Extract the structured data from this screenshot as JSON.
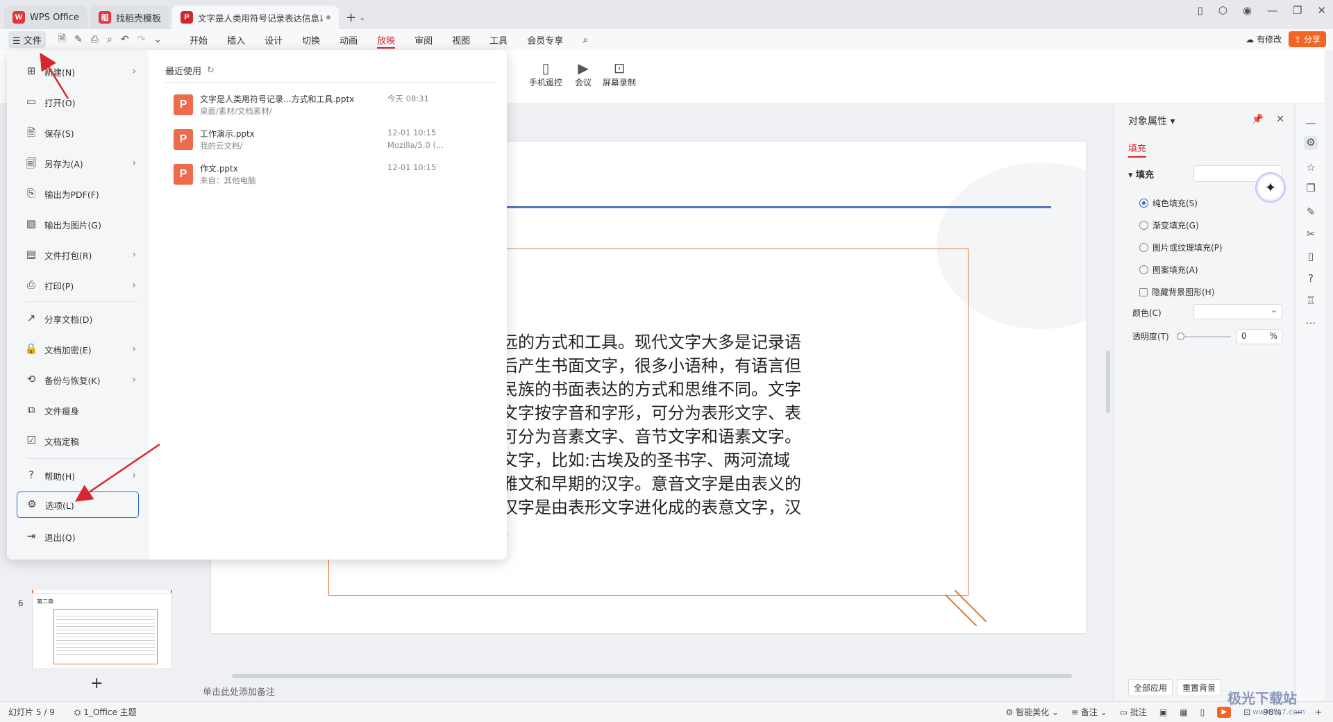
{
  "tabs": [
    {
      "label": "WPS Office",
      "logo": "W",
      "color": "#e8343b"
    },
    {
      "label": "找稻壳模板",
      "logo": "稻",
      "color": "#e8343b"
    },
    {
      "label": "文字是人类用符号记录表达信息以",
      "logo": "P",
      "color": "#d2272b"
    }
  ],
  "menubar": {
    "file_label": "☰ 文件",
    "items": [
      "开始",
      "插入",
      "设计",
      "切换",
      "动画",
      "放映",
      "审阅",
      "视图",
      "工具",
      "会员专享"
    ],
    "active": "放映",
    "modified": "有修改",
    "share": "分享"
  },
  "ribbon_tools": [
    {
      "label": "手机遥控",
      "icon": "phone-icon"
    },
    {
      "label": "会议",
      "icon": "video-icon"
    },
    {
      "label": "屏幕录制",
      "icon": "record-icon"
    }
  ],
  "slide": {
    "lines": [
      "达信息以传之久远的方式和工具。现代文字大多是记录语",
      "先有口头的语言后产生书面文字，很多小语种，有语言但",
      "同体现了国家和民族的书面表达的方式和思维不同。文字",
      "录的文明社会。文字按字音和字形，可分为表形文字、表",
      "按语音和语素，可分为音素文字、音节文字和语素文字。",
      "原生文字的象形文字，比如:古埃及的圣书字、两河流域",
      "文字、美洲的玛雅文和早期的汉字。意音文字是由表义的",
      "旁组成的文字，汉字是由表形文字进化成的表意文字，汉",
      "是一种二维文字。"
    ]
  },
  "thumbnails": {
    "num6": "6",
    "title6": "第二章"
  },
  "notes_placeholder": "单击此处添加备注",
  "props": {
    "title": "对象属性 ▾",
    "tab": "填充",
    "section": "▾ 填充",
    "options": [
      "纯色填充(S)",
      "渐变填充(G)",
      "图片或纹理填充(P)",
      "图案填充(A)"
    ],
    "selected_option": 0,
    "hide_bg": "隐藏背景图形(H)",
    "color_label": "颜色(C)",
    "opacity_label": "透明度(T)",
    "opacity_value": "0",
    "opacity_unit": "%",
    "apply_all": "全部应用",
    "reset_bg": "重置背景"
  },
  "filemenu": {
    "items": [
      {
        "label": "新建(N)",
        "icon": "new-icon",
        "arrow": true
      },
      {
        "label": "打开(O)",
        "icon": "folder-icon",
        "arrow": false
      },
      {
        "label": "保存(S)",
        "icon": "save-icon",
        "arrow": false
      },
      {
        "label": "另存为(A)",
        "icon": "save-as-icon",
        "arrow": true
      },
      {
        "label": "输出为PDF(F)",
        "icon": "pdf-icon",
        "arrow": false
      },
      {
        "label": "输出为图片(G)",
        "icon": "image-icon",
        "arrow": false
      },
      {
        "label": "文件打包(R)",
        "icon": "package-icon",
        "arrow": true
      },
      {
        "label": "打印(P)",
        "icon": "print-icon",
        "arrow": true
      },
      {
        "label": "分享文档(D)",
        "icon": "share-icon",
        "arrow": false
      },
      {
        "label": "文档加密(E)",
        "icon": "lock-icon",
        "arrow": true
      },
      {
        "label": "备份与恢复(K)",
        "icon": "backup-icon",
        "arrow": true
      },
      {
        "label": "文件瘦身",
        "icon": "slim-icon",
        "arrow": false
      },
      {
        "label": "文档定稿",
        "icon": "finalize-icon",
        "arrow": false
      },
      {
        "label": "帮助(H)",
        "icon": "help-icon",
        "arrow": true
      },
      {
        "label": "选项(L)",
        "icon": "gear-icon",
        "arrow": false
      },
      {
        "label": "退出(Q)",
        "icon": "exit-icon",
        "arrow": false
      }
    ],
    "recent_title": "最近使用",
    "recent": [
      {
        "name": "文字是人类用符号记录...方式和工具.pptx",
        "path": "桌面/素材/文档素材/",
        "time": "今天 08:31",
        "time2": ""
      },
      {
        "name": "工作演示.pptx",
        "path": "我的云文档/",
        "time": "12-01 10:15",
        "time2": "Mozilla/5.0 (..."
      },
      {
        "name": "作文.pptx",
        "path": "来自：其他电脑",
        "time": "12-01 10:15",
        "time2": ""
      }
    ]
  },
  "status": {
    "slide_info": "幻灯片 5 / 9",
    "theme": "1_Office 主题",
    "beautify": "智能美化",
    "notes": "备注",
    "comments": "批注",
    "zoom": "98%"
  },
  "watermark": "极光下载站",
  "watermark_url": "www.xz7.com"
}
